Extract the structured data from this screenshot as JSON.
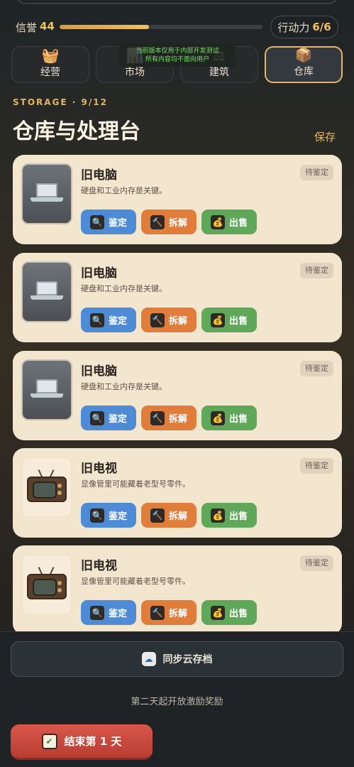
{
  "status": {
    "reputation_label": "信誉",
    "reputation_value": "44",
    "action_label": "行动力",
    "action_value": "6/6"
  },
  "tabs": [
    {
      "label": "经营",
      "icon": "basket-icon"
    },
    {
      "label": "市场",
      "icon": "chart-icon"
    },
    {
      "label": "建筑",
      "icon": "scale-icon"
    },
    {
      "label": "仓库",
      "icon": "package-icon",
      "active": true
    }
  ],
  "dev_banner": {
    "line1": "当前版本仅用于内部开发测试",
    "line2": "所有内容均不面向用户"
  },
  "storage": {
    "subtitle": "STORAGE · 9/12",
    "title": "仓库与处理台",
    "save_label": "保存"
  },
  "actions": {
    "inspect": "鉴定",
    "dismantle": "拆解",
    "sell": "出售"
  },
  "items": [
    {
      "name": "旧电脑",
      "desc": "硬盘和工业内存是关键。",
      "badge": "待鉴定",
      "kind": "computer"
    },
    {
      "name": "旧电脑",
      "desc": "硬盘和工业内存是关键。",
      "badge": "待鉴定",
      "kind": "computer"
    },
    {
      "name": "旧电脑",
      "desc": "硬盘和工业内存是关键。",
      "badge": "待鉴定",
      "kind": "computer"
    },
    {
      "name": "旧电视",
      "desc": "显像管里可能藏着老型号零件。",
      "badge": "待鉴定",
      "kind": "tv"
    },
    {
      "name": "旧电视",
      "desc": "显像管里可能藏着老型号零件。",
      "badge": "待鉴定",
      "kind": "tv"
    }
  ],
  "footer": {
    "sync_label": "同步云存档",
    "reward_note": "第二天起开放激励奖励",
    "end_day_label": "结束第 1 天"
  },
  "colors": {
    "accent": "#e3b663",
    "card_bg": "#f3e6cf",
    "inspect": "#4e8bd6",
    "dismantle": "#e07d3a",
    "sell": "#5fa85a",
    "end_day": "#c9483d"
  }
}
